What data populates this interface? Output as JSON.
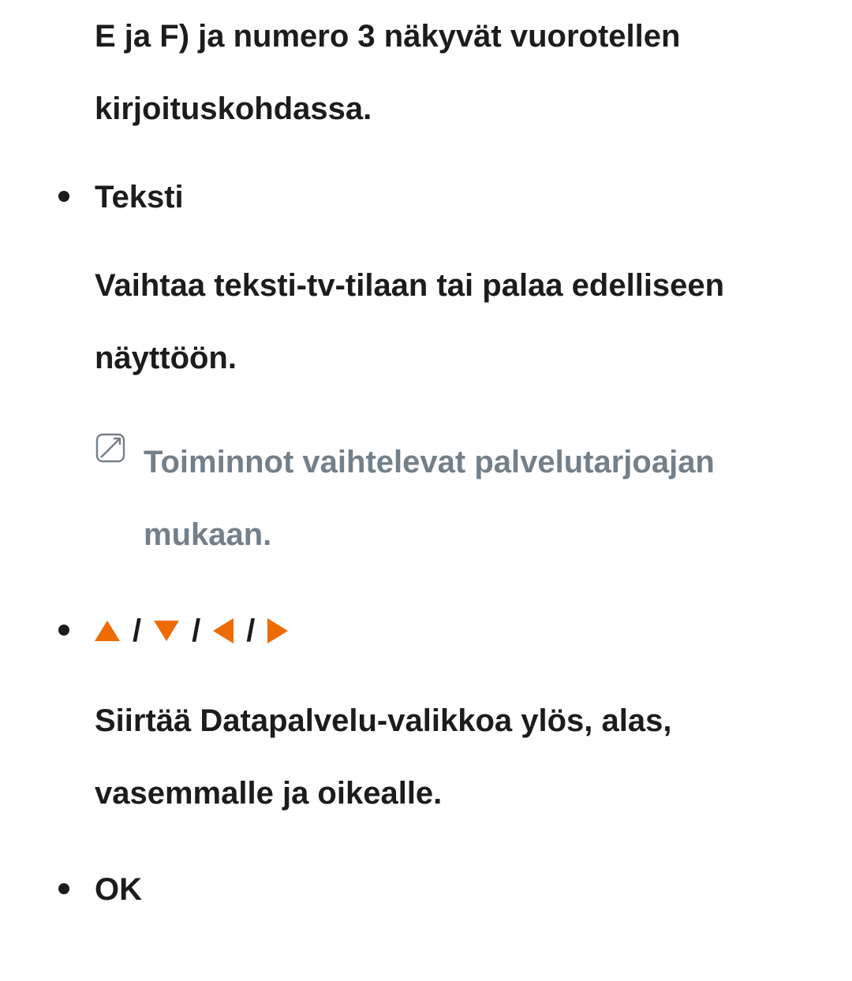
{
  "continuation": "E ja F) ja numero 3 näkyvät vuorotellen kirjoituskohdassa.",
  "items": [
    {
      "title": "Teksti",
      "desc": "Vaihtaa teksti-tv-tilaan tai palaa edelliseen näyttöön.",
      "note": "Toiminnot vaihtelevat palvelutarjoajan mukaan."
    },
    {
      "arrows": {
        "sep": "/"
      },
      "desc": "Siirtää Datapalvelu-valikkoa ylös, alas, vasemmalle ja oikealle."
    },
    {
      "title": "OK"
    }
  ]
}
